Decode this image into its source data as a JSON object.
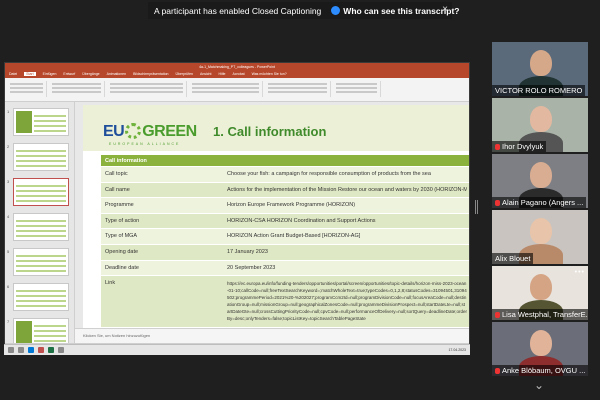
{
  "caption_banner": {
    "message": "A participant has enabled Closed Captioning",
    "who_label": "Who can see this transcript?",
    "close_icon": "×"
  },
  "powerpoint": {
    "window_title": "4a-1_Matchmaking_PT_colleagues - PowerPoint",
    "menu": [
      "Datei",
      "Start",
      "Einfügen",
      "Entwurf",
      "Übergänge",
      "Animationen",
      "Bildschirmpräsentation",
      "Überprüfen",
      "Ansicht",
      "Hilfe",
      "Acrobat",
      "Was möchten Sie tun?"
    ],
    "active_menu_index": 1,
    "thumbnails": [
      "1",
      "2",
      "3",
      "4",
      "5",
      "6",
      "7"
    ],
    "selected_thumbnail_index": 2,
    "notes_placeholder": "Klicken Sie, um Notizen hinzuzufügen",
    "status_text": "Folie 3 von 7   Englisch (Vereinigtes Königreich)"
  },
  "slide": {
    "logo_eu": "EU",
    "logo_green": "GREEN",
    "tagline": "EUROPEAN ALLIANCE",
    "title": "1. Call information",
    "table_header": "Call information",
    "rows": [
      {
        "key": "Call topic",
        "value": "Choose your fish: a campaign for responsible consumption of products from the sea"
      },
      {
        "key": "Call name",
        "value": "Actions for the implementation of the Mission Restore our ocean and waters by 2030 (HORIZON-MISS-2023-OCEAN-01)"
      },
      {
        "key": "Programme",
        "value": "Horizon Europe Framework Programme (HORIZON)"
      },
      {
        "key": "Type of action",
        "value": "HORIZON-CSA HORIZON Coordination and Support Actions"
      },
      {
        "key": "Type of MGA",
        "value": "HORIZON Action Grant Budget-Based [HORIZON-AG]"
      },
      {
        "key": "Opening date",
        "value": "17 January 2023"
      },
      {
        "key": "Deadline date",
        "value": "20 September 2023"
      }
    ],
    "link_key": "Link",
    "link_value": "https://ec.europa.eu/info/funding-tenders/opportunities/portal/screen/opportunities/topic-details/horizon-miss-2023-ocean-01-10;callCode=null;freeTextSearchKeyword=;matchWholeText=true;typeCodes=0,1,2,8;statusCodes=31094501,31094502;programmePeriod=2021%20-%202027;programCcm2Id=null;programDivisionCode=null;focusAreaCode=null;destinationGroup=null;missionGroup=null;geographicalZonesCode=null;programmeDivisionProspect=null;startDateLte=null;startDateGte=null;crossCuttingPriorityCode=null;cpvCode=null;performanceOfDelivery=null;sortQuery=deadlineDate;orderBy=desc;onlyTenders=false;topicListKey=topicSearchTablePageState"
  },
  "taskbar": {
    "clock": "17.04.2023"
  },
  "participants": [
    {
      "name": "VICTOR ROLO ROMERO",
      "muted": false
    },
    {
      "name": "Ihor Dvylyuk",
      "muted": true
    },
    {
      "name": "Alain Pagano (Angers ...",
      "muted": true
    },
    {
      "name": "Alix Blouet",
      "muted": false
    },
    {
      "name": "Lisa Westphal, TransferE...",
      "muted": true,
      "active": true
    },
    {
      "name": "Anke Blöbaum, OVGU ...",
      "muted": true
    }
  ],
  "colors": {
    "powerpoint_accent": "#b7472a",
    "table_header": "#8cb23e",
    "active_speaker": "#c8e63a",
    "logo_blue": "#1f4e9b",
    "logo_green": "#4a9c2d"
  }
}
